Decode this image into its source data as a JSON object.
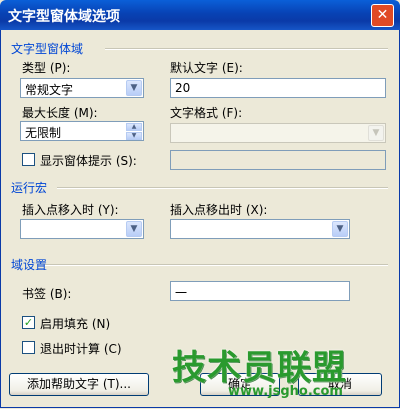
{
  "window": {
    "title": "文字型窗体域选项",
    "close_label": "✕"
  },
  "sections": {
    "field": "文字型窗体域",
    "macro": "运行宏",
    "settings": "域设置"
  },
  "field": {
    "type_label": "类型 (P):",
    "type_value": "常规文字",
    "default_text_label": "默认文字 (E):",
    "default_text_value": "20",
    "maxlen_label": "最大长度 (M):",
    "maxlen_value": "无限制",
    "format_label": "文字格式 (F):",
    "format_value": "",
    "show_hint_label": "显示窗体提示 (S):",
    "show_hint_value": ""
  },
  "macro": {
    "entry_label": "插入点移入时 (Y):",
    "entry_value": "",
    "exit_label": "插入点移出时 (X):",
    "exit_value": ""
  },
  "settings": {
    "bookmark_label": "书签 (B):",
    "bookmark_value": "一",
    "enable_fill_label": "启用填充 (N)",
    "enable_fill_checked": true,
    "calc_on_exit_label": "退出时计算 (C)",
    "calc_on_exit_checked": false
  },
  "buttons": {
    "help": "添加帮助文字 (T)...",
    "ok": "确定",
    "cancel": "取消"
  },
  "watermark": {
    "text": "技术员联盟",
    "url": "www.jsgho.com"
  },
  "colors": {
    "title_bar": "#0842b4",
    "group_label": "#0046d5",
    "dialog_bg": "#ece9d8",
    "watermark": "#2a9a2e"
  }
}
